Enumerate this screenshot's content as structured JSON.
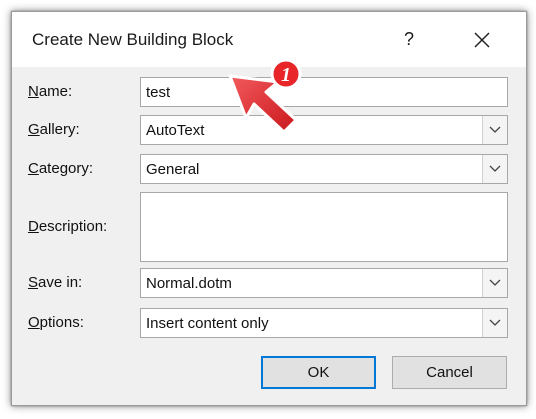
{
  "dialog": {
    "title": "Create New Building Block",
    "help_label": "?",
    "close_icon": "close-icon"
  },
  "fields": {
    "name": {
      "label_underlined": "N",
      "label_rest": "ame:",
      "value": "test"
    },
    "gallery": {
      "label_underlined": "G",
      "label_rest": "allery:",
      "value": "AutoText"
    },
    "category": {
      "label_underlined": "C",
      "label_rest": "ategory:",
      "value": "General"
    },
    "description": {
      "label_underlined": "D",
      "label_rest": "escription:",
      "value": ""
    },
    "save_in": {
      "label_underlined": "S",
      "label_rest": "ave in:",
      "value": "Normal.dotm"
    },
    "options": {
      "label_underlined": "O",
      "label_rest": "ptions:",
      "value": "Insert content only"
    }
  },
  "buttons": {
    "ok": "OK",
    "cancel": "Cancel"
  },
  "annotation": {
    "step_number": "1",
    "arrow_color": "#e8262a",
    "badge_color": "#e8262a"
  },
  "colors": {
    "ok_border": "#0078d7",
    "dialog_bg": "#f0f0f0"
  }
}
